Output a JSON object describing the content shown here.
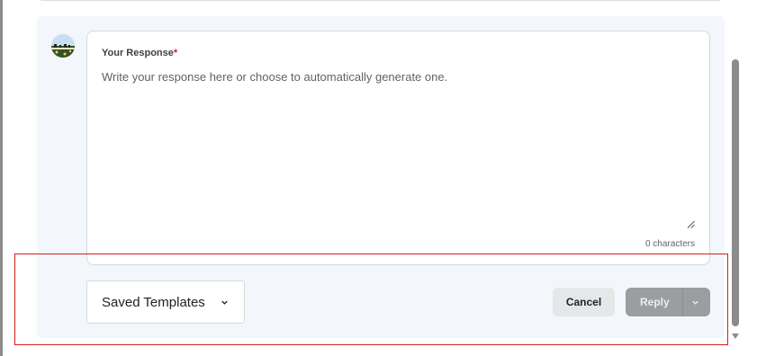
{
  "response": {
    "label": "Your Response",
    "required_marker": "*",
    "placeholder": "Write your response here or choose to automatically generate one.",
    "char_count": "0 characters"
  },
  "footer": {
    "templates_label": "Saved Templates",
    "cancel_label": "Cancel",
    "reply_label": "Reply"
  },
  "icons": {
    "avatar": "avatar-photo",
    "templates_chevron": "chevron-down-icon",
    "reply_chevron": "chevron-down-icon",
    "resize": "resize-grip-icon",
    "scroll_down": "arrow-down-icon"
  },
  "colors": {
    "panel_bg": "#f3f6fb",
    "required": "#c5221f",
    "highlight": "#d81b1b",
    "reply_bg": "#9b9da1",
    "cancel_bg": "#e6e7e9"
  }
}
